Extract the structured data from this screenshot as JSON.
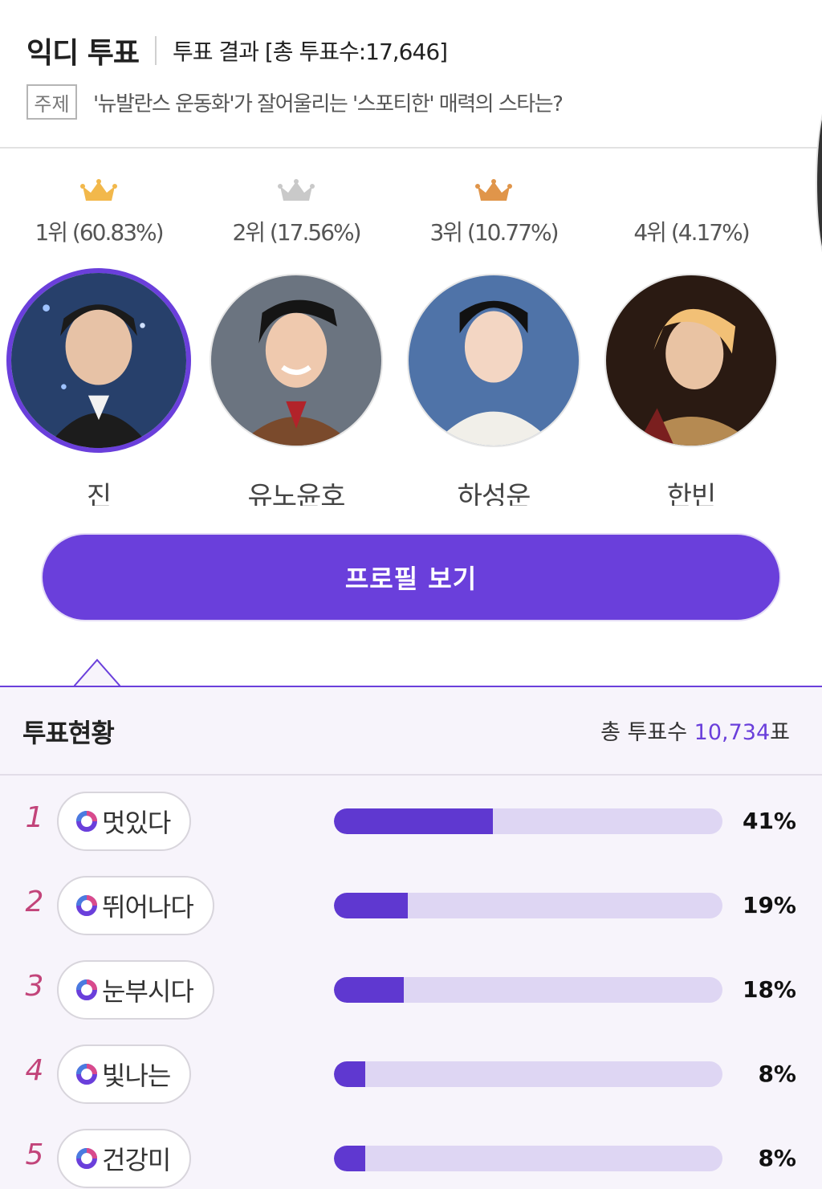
{
  "header": {
    "brand": "익디 투표",
    "result_title": "투표 결과 [총 투표수:17,646]",
    "topic_tag": "주제",
    "topic_text": "'뉴발란스 운동화'가 잘어울리는 '스포티한' 매력의 스타는?"
  },
  "ranking": [
    {
      "label": "1위 (60.83%)",
      "name": "진",
      "crown": "gold-crown-icon",
      "crown_color": "#f2b84b"
    },
    {
      "label": "2위 (17.56%)",
      "name": "유노윤호",
      "crown": "silver-crown-icon",
      "crown_color": "#c9c9c9"
    },
    {
      "label": "3위 (10.77%)",
      "name": "하성운",
      "crown": "bronze-crown-icon",
      "crown_color": "#e0954a"
    },
    {
      "label": "4위 (4.17%)",
      "name": "한빈",
      "crown": "",
      "crown_color": ""
    }
  ],
  "profile_button": "프로필 보기",
  "status": {
    "title": "투표현황",
    "total_prefix": "총 투표수",
    "total_value": "10,734",
    "total_suffix": "표",
    "items": [
      {
        "rank": "1",
        "word": "멋있다",
        "percent_label": "41%",
        "fraction": 0.41
      },
      {
        "rank": "2",
        "word": "뛰어나다",
        "percent_label": "19%",
        "fraction": 0.19
      },
      {
        "rank": "3",
        "word": "눈부시다",
        "percent_label": "18%",
        "fraction": 0.18
      },
      {
        "rank": "4",
        "word": "빛나는",
        "percent_label": "8%",
        "fraction": 0.08
      },
      {
        "rank": "5",
        "word": "건강미",
        "percent_label": "8%",
        "fraction": 0.08
      }
    ]
  },
  "colors": {
    "accent": "#6a3fdb",
    "bar_fill": "#5f38d0",
    "bar_track": "#ded6f3",
    "rank_number": "#c2447a"
  }
}
